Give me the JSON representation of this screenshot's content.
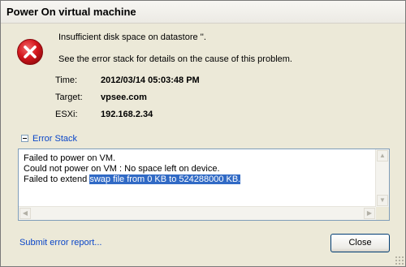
{
  "window": {
    "title": "Power On virtual machine"
  },
  "message": {
    "icon": "error-icon",
    "line1": "Insufficient disk space on datastore ''.",
    "line2": "See the error stack for details on the cause of this problem."
  },
  "details": [
    {
      "label": "Time:",
      "value": "2012/03/14 05:03:48 PM"
    },
    {
      "label": "Target:",
      "value": "vpsee.com"
    },
    {
      "label": "ESXi:",
      "value": "192.168.2.34"
    }
  ],
  "error_stack": {
    "toggle_label": "Error Stack",
    "lines": [
      "Failed to power on VM.",
      "Could not power on VM : No space left on device.",
      "Failed to extend"
    ],
    "selected_text": "swap file from 0 KB to 524288000 KB."
  },
  "footer": {
    "submit_link": "Submit error report...",
    "close_button": "Close"
  },
  "colors": {
    "background": "#ece9d8",
    "link": "#0a46c8",
    "selection": "#316ac5",
    "error_red": "#c8102e"
  }
}
